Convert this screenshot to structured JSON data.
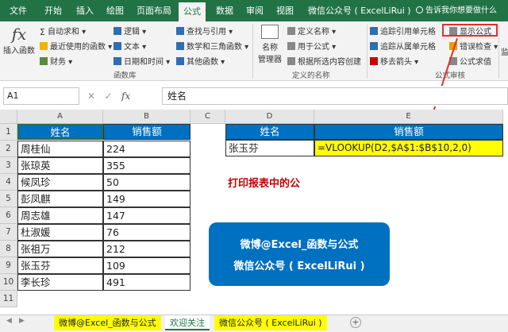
{
  "menu": {
    "tabs": [
      "文件",
      "开始",
      "插入",
      "绘图",
      "页面布局",
      "公式",
      "数据",
      "审阅",
      "视图",
      "微信公众号 ( ExcelLiRui )"
    ],
    "active_tab": "公式",
    "tell_me": "告诉我你想要做什么"
  },
  "ribbon": {
    "insert_function": "插入函数",
    "autosum": "自动求和",
    "recent": "最近使用的函数",
    "financial": "财务",
    "logical": "逻辑",
    "text": "文本",
    "datetime": "日期和时间",
    "lookup": "查找与引用",
    "math": "数学和三角函数",
    "more": "其他函数",
    "group_library": "函数库",
    "name_manager": "名称\n管理器",
    "name_manager_l1": "名称",
    "name_manager_l2": "管理器",
    "define_name": "定义名称",
    "use_in_formula": "用于公式",
    "create_from_selection": "根据所选内容创建",
    "group_names": "定义的名称",
    "trace_precedents": "追踪引用单元格",
    "trace_dependents": "追踪从属单元格",
    "remove_arrows": "移去箭头",
    "show_formulas": "显示公式",
    "error_checking": "错误检查",
    "evaluate_formula": "公式求值",
    "group_audit": "公式审核",
    "watch": "监"
  },
  "formula_bar": {
    "name_box": "A1",
    "fx": "fx",
    "value": "姓名"
  },
  "columns": [
    "A",
    "B",
    "C",
    "D",
    "E"
  ],
  "rows": [
    "1",
    "2",
    "3",
    "4",
    "5",
    "6",
    "7",
    "8",
    "9",
    "10",
    "11"
  ],
  "table_left": {
    "headers": [
      "姓名",
      "销售额"
    ],
    "data": [
      [
        "周桂仙",
        "224"
      ],
      [
        "张琼英",
        "355"
      ],
      [
        "候凤珍",
        "50"
      ],
      [
        "彭凤麒",
        "149"
      ],
      [
        "周志雄",
        "147"
      ],
      [
        "杜淑媛",
        "76"
      ],
      [
        "张祖万",
        "212"
      ],
      [
        "张玉芬",
        "109"
      ],
      [
        "李长珍",
        "491"
      ]
    ]
  },
  "table_right": {
    "headers": [
      "姓名",
      "销售额"
    ],
    "name": "张玉芬",
    "formula": "=VLOOKUP(D2,$A$1:$B$10,2,0)"
  },
  "note": "打印报表中的公",
  "promo": {
    "line1": "微博@Excel_函数与公式",
    "line2": "微信公众号 ( ExcelLiRui )"
  },
  "sheet_tabs": [
    "微博@Excel_函数与公式",
    "欢迎关注",
    "微信公众号 ( ExcelLiRui )"
  ],
  "colors": {
    "excel_green": "#217346",
    "header_blue": "#0070c0",
    "highlight_yellow": "#ffff00",
    "note_red": "#c00000"
  }
}
